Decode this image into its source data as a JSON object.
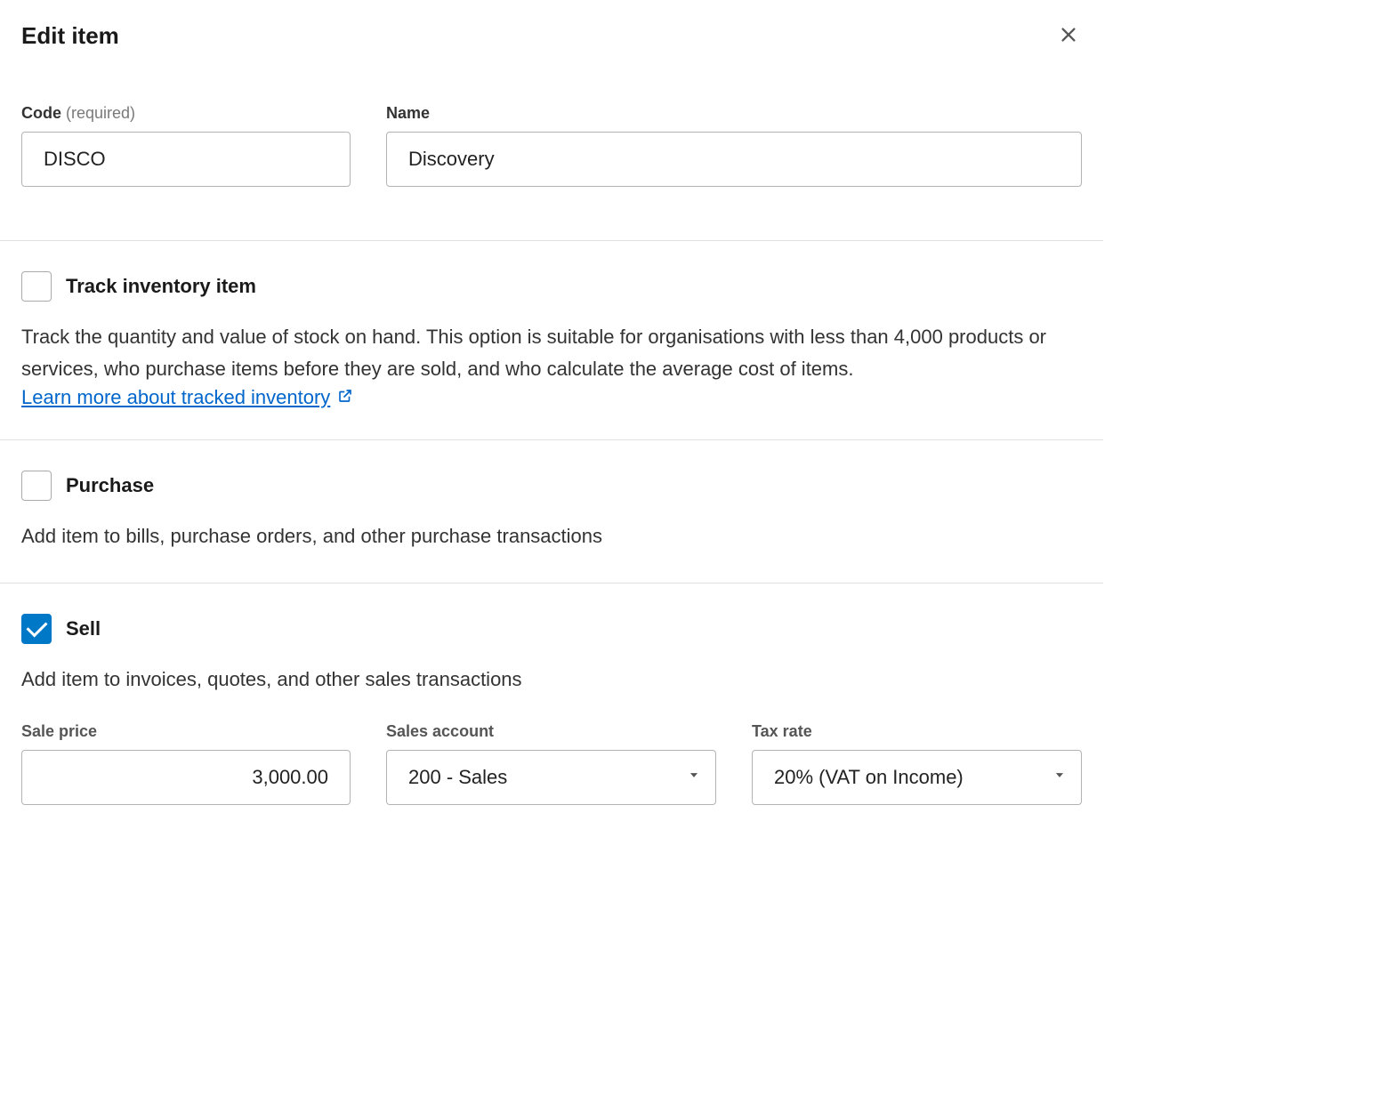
{
  "header": {
    "title": "Edit item"
  },
  "fields": {
    "code": {
      "label_strong": "Code",
      "label_req": "(required)",
      "value": "DISCO"
    },
    "name": {
      "label": "Name",
      "value": "Discovery"
    }
  },
  "track": {
    "label": "Track inventory item",
    "checked": false,
    "description": "Track the quantity and value of stock on hand. This option is suitable for organisations with less than 4,000 products or services, who purchase items before they are sold, and who calculate the average cost of items.",
    "link_text": "Learn more about tracked inventory"
  },
  "purchase": {
    "label": "Purchase",
    "checked": false,
    "description": "Add item to bills, purchase orders, and other purchase transactions"
  },
  "sell": {
    "label": "Sell",
    "checked": true,
    "description": "Add item to invoices, quotes, and other sales transactions",
    "sale_price": {
      "label": "Sale price",
      "value": "3,000.00"
    },
    "sales_account": {
      "label": "Sales account",
      "value": "200 - Sales"
    },
    "tax_rate": {
      "label": "Tax rate",
      "value": "20% (VAT on Income)"
    }
  }
}
